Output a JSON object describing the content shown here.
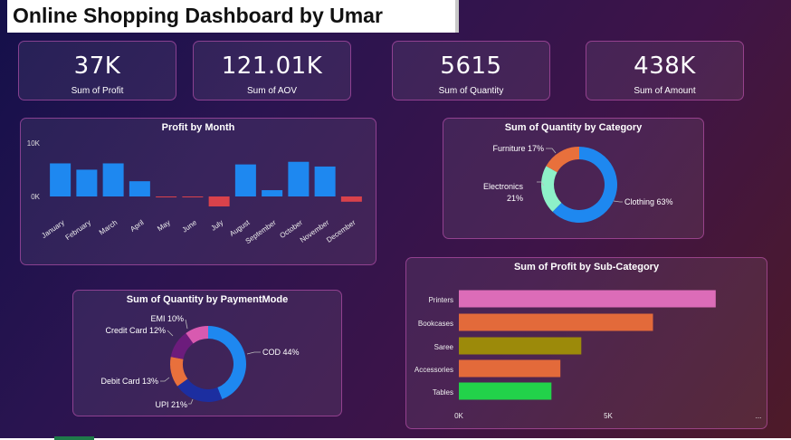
{
  "dashboard": {
    "title": "Online Shopping Dashboard by Umar"
  },
  "kpis": [
    {
      "value": "37K",
      "label": "Sum of Profit"
    },
    {
      "value": "121.01K",
      "label": "Sum of AOV"
    },
    {
      "value": "5615",
      "label": "Sum of Quantity"
    },
    {
      "value": "438K",
      "label": "Sum of Amount"
    }
  ],
  "colors": {
    "bar_positive": "#1e88f0",
    "bar_negative": "#d9424b",
    "card_border": "#c95ab8"
  },
  "chart_data": [
    {
      "id": "profit_by_month",
      "type": "bar",
      "title": "Profit by Month",
      "categories": [
        "January",
        "February",
        "March",
        "April",
        "May",
        "June",
        "July",
        "August",
        "September",
        "October",
        "November",
        "December"
      ],
      "values": [
        6300,
        5100,
        6300,
        2900,
        -100,
        -150,
        -1900,
        6100,
        1200,
        6600,
        5700,
        -1000
      ],
      "yticks": [
        "10K",
        "0K"
      ],
      "ylim": [
        -3000,
        10000
      ]
    },
    {
      "id": "quantity_by_category",
      "type": "pie",
      "title": "Sum of Quantity by Category",
      "labels": [
        "Clothing",
        "Electronics",
        "Furniture"
      ],
      "values": [
        63,
        21,
        17
      ],
      "display_labels": [
        "Clothing 63%",
        "Electronics",
        "21%",
        "Furniture 17%"
      ],
      "colors": [
        "#1e88f0",
        "#8ef0c8",
        "#e8703c"
      ]
    },
    {
      "id": "quantity_by_paymentmode",
      "type": "pie",
      "title": "Sum of Quantity by PaymentMode",
      "labels": [
        "COD",
        "UPI",
        "Debit Card",
        "Credit Card",
        "EMI"
      ],
      "values": [
        44,
        21,
        13,
        12,
        10
      ],
      "display_labels": [
        "COD 44%",
        "UPI 21%",
        "Debit Card 13%",
        "Credit Card 12%",
        "EMI 10%"
      ],
      "colors": [
        "#1e88f0",
        "#1c2ea0",
        "#e8703c",
        "#6c1c7c",
        "#d85ab0"
      ]
    },
    {
      "id": "profit_by_subcategory",
      "type": "bar",
      "orientation": "horizontal",
      "title": "Sum of Profit by Sub-Category",
      "categories": [
        "Printers",
        "Bookcases",
        "Saree",
        "Accessories",
        "Tables"
      ],
      "values": [
        8600,
        6500,
        4100,
        3400,
        3100
      ],
      "colors": [
        "#dc6cb8",
        "#e36a3a",
        "#9c8a0a",
        "#e36a3a",
        "#22d24a"
      ],
      "xticks": [
        "0K",
        "5K",
        "..."
      ],
      "xlim": [
        0,
        10000
      ]
    }
  ]
}
